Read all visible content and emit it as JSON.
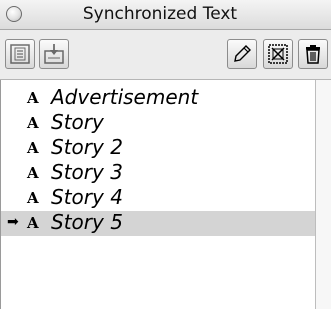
{
  "window": {
    "title": "Synchronized Text",
    "close_icon": "close-circle-icon"
  },
  "toolbar": {
    "buttons": [
      {
        "name": "import-text-button",
        "icon": "import-text-icon"
      },
      {
        "name": "place-text-button",
        "icon": "place-text-icon"
      },
      {
        "name": "edit-button",
        "icon": "pencil-icon"
      },
      {
        "name": "unlink-button",
        "icon": "unlink-frame-icon"
      },
      {
        "name": "delete-button",
        "icon": "trash-icon"
      }
    ]
  },
  "list": {
    "items": [
      {
        "label": "Advertisement",
        "icon": "A",
        "selected": false,
        "marker": ""
      },
      {
        "label": "Story",
        "icon": "A",
        "selected": false,
        "marker": ""
      },
      {
        "label": "Story 2",
        "icon": "A",
        "selected": false,
        "marker": ""
      },
      {
        "label": "Story 3",
        "icon": "A",
        "selected": false,
        "marker": ""
      },
      {
        "label": "Story 4",
        "icon": "A",
        "selected": false,
        "marker": ""
      },
      {
        "label": "Story 5",
        "icon": "A",
        "selected": true,
        "marker": "➡"
      }
    ]
  },
  "colors": {
    "selection": "#d4d4d4",
    "toolbar": "#ececec"
  }
}
